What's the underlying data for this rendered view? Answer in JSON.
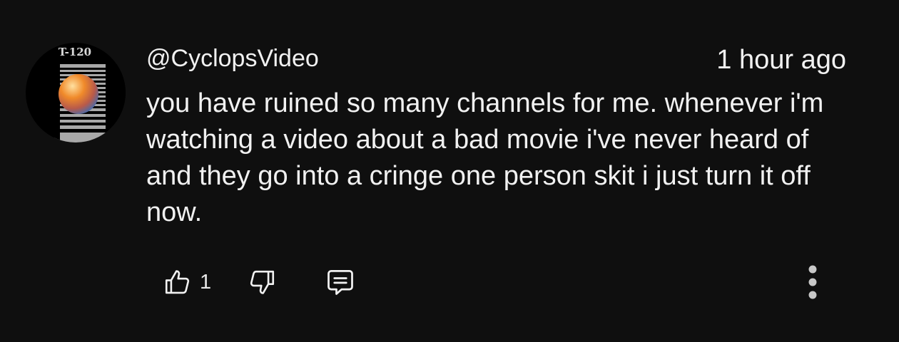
{
  "comment": {
    "avatar_label": "T-120",
    "handle": "@CyclopsVideo",
    "timestamp": "1 hour ago",
    "text": "you have ruined so many channels for me. whenever i'm watching a video about a bad movie i've never heard of and they go into a cringe one person skit i just turn it off now.",
    "like_count": "1"
  },
  "icons": {
    "like": "thumbs-up-icon",
    "dislike": "thumbs-down-icon",
    "reply": "reply-comment-icon",
    "more": "more-vertical-icon"
  },
  "colors": {
    "background": "#0f0f0f",
    "text": "#f1f1f1"
  }
}
